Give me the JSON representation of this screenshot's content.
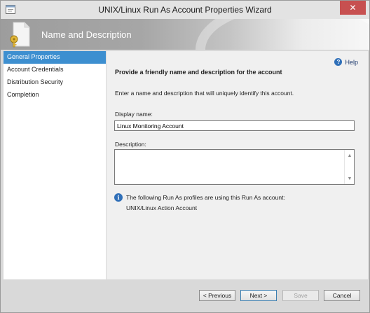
{
  "window": {
    "title": "UNIX/Linux Run As Account Properties Wizard",
    "close_glyph": "✕"
  },
  "banner": {
    "title": "Name and Description"
  },
  "nav": {
    "items": [
      {
        "label": "General Properties",
        "active": true
      },
      {
        "label": "Account Credentials",
        "active": false
      },
      {
        "label": "Distribution Security",
        "active": false
      },
      {
        "label": "Completion",
        "active": false
      }
    ]
  },
  "content": {
    "help": "Help",
    "heading": "Provide a friendly name and description for the account",
    "instruction": "Enter a name and description that will uniquely identify this account.",
    "display_name_label": "Display name:",
    "display_name_value": "Linux Monitoring Account",
    "description_label": "Description:",
    "description_value": "",
    "info_text": "The following Run As profiles are using this Run As account:",
    "profiles": [
      "UNIX/Linux Action Account"
    ]
  },
  "footer": {
    "previous": "< Previous",
    "next": "Next >",
    "save": "Save",
    "cancel": "Cancel"
  }
}
